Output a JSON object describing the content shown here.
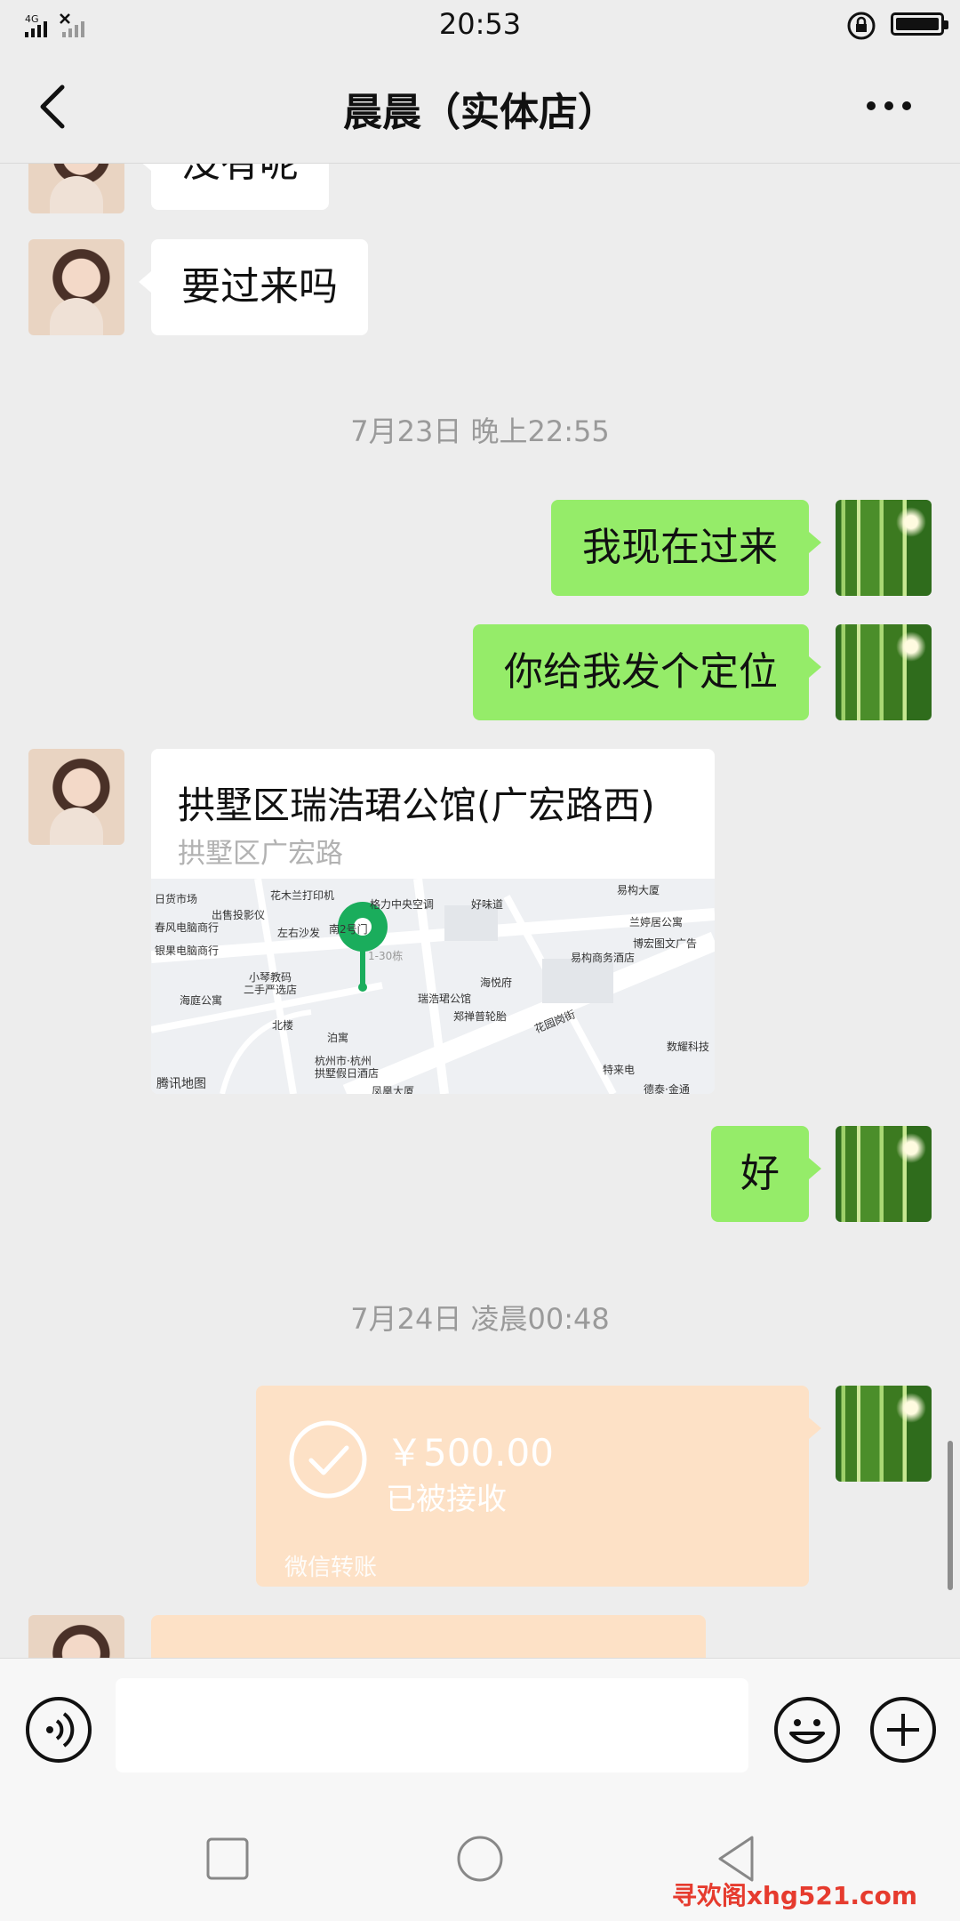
{
  "status_bar": {
    "network": "4G",
    "time": "20:53"
  },
  "header": {
    "title": "晨晨（实体店）"
  },
  "messages": [
    {
      "side": "in",
      "text": "没有呢"
    },
    {
      "side": "in",
      "text": "要过来吗"
    },
    {
      "type": "time",
      "text": "7月23日 晚上22:55"
    },
    {
      "side": "out",
      "text": "我现在过来"
    },
    {
      "side": "out",
      "text": "你给我发个定位"
    },
    {
      "side": "in",
      "type": "location",
      "title": "拱墅区瑞浩珺公馆(广宏路西)",
      "address": "拱墅区广宏路",
      "map_labels": [
        "日货市场",
        "花木兰打印机",
        "格力中央空调",
        "好味道",
        "易构大厦",
        "出售投影仪",
        "南2号门",
        "兰婷居公寓",
        "春风电脑商行",
        "左右沙发",
        "博宏图文广告",
        "1-30栋",
        "易构商务酒店",
        "银果电脑商行",
        "小琴教码",
        "二手严选店",
        "海悦府",
        "海庭公寓",
        "瑞浩珺公馆",
        "郑禅普轮胎",
        "北楼",
        "泊寓",
        "花园岗街",
        "数耀科技",
        "杭州市·杭州",
        "拱墅假日酒店",
        "特来电",
        "德泰·金通",
        "凤凰大厦"
      ],
      "map_brand": "腾讯地图"
    },
    {
      "side": "out",
      "text": "好"
    },
    {
      "type": "time",
      "text": "7月24日 凌晨00:48"
    },
    {
      "side": "out",
      "type": "transfer",
      "amount": "￥500.00",
      "status": "已被接收",
      "footer": "微信转账"
    },
    {
      "side": "in",
      "type": "transfer"
    }
  ],
  "watermark": "寻欢阁xhg521.com",
  "colors": {
    "outgoing_bubble": "#95ec69",
    "incoming_bubble": "#ffffff",
    "transfer": "#fde1c6",
    "background": "#ededed"
  }
}
